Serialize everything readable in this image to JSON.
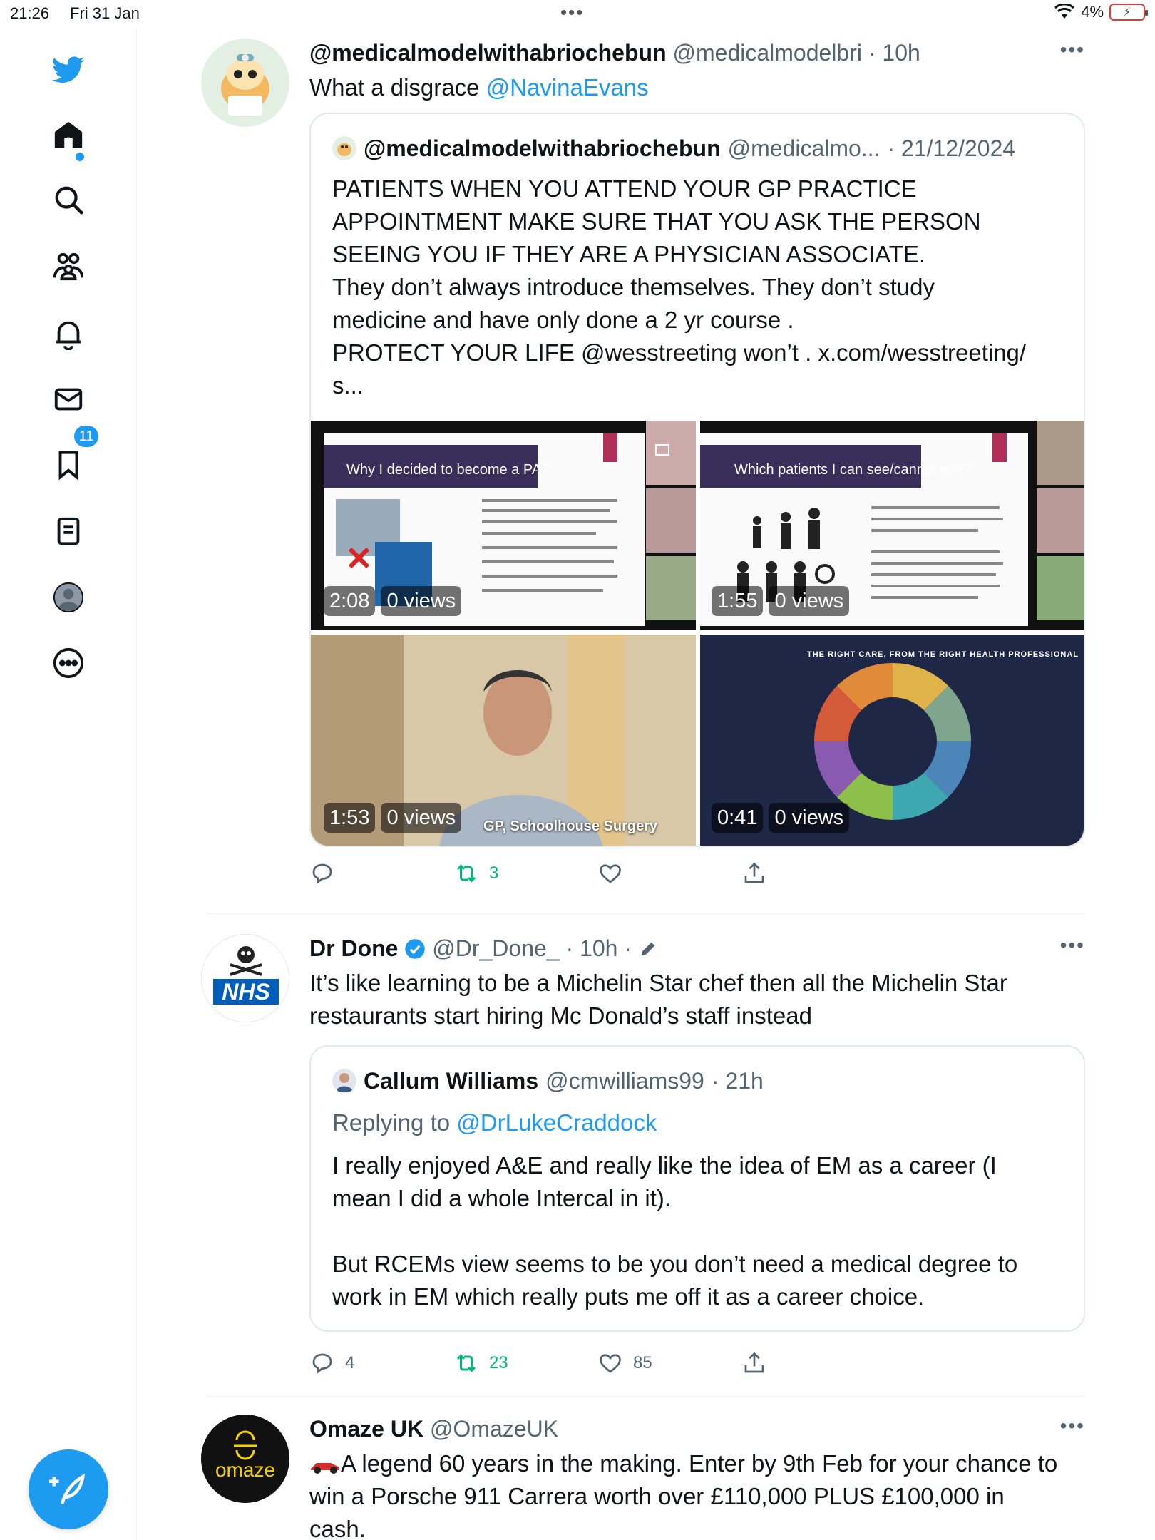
{
  "status_bar": {
    "time": "21:26",
    "date": "Fri 31 Jan",
    "battery": "4%"
  },
  "sidebar": {
    "items": [
      {
        "icon": "twitter-bird-icon"
      },
      {
        "icon": "home-icon"
      },
      {
        "icon": "search-icon"
      },
      {
        "icon": "communities-icon"
      },
      {
        "icon": "notifications-icon",
        "badge": "11"
      },
      {
        "icon": "messages-icon"
      },
      {
        "icon": "bookmarks-icon"
      },
      {
        "icon": "lists-icon"
      },
      {
        "icon": "profile-icon"
      },
      {
        "icon": "more-icon"
      }
    ],
    "compose_icon": "compose-icon"
  },
  "tweets": [
    {
      "name": "@medicalmodelwithabriochebun",
      "handle": "@medicalmodelbri",
      "time": "· 10h",
      "text": "What a disgrace ",
      "mention": "@NavinaEvans",
      "quote": {
        "name": "@medicalmodelwithabriochebun",
        "handle": "@medicalmo...",
        "time": "· 21/12/2024",
        "lines": [
          "PATIENTS WHEN YOU ATTEND YOUR GP PRACTICE",
          "APPOINTMENT MAKE SURE THAT YOU ASK THE PERSON",
          "SEEING YOU IF THEY ARE A PHYSICIAN ASSOCIATE.",
          "They don’t always introduce themselves. They don’t study",
          "medicine and have only done a 2 yr course .",
          "PROTECT YOUR LIFE @wesstreeting won’t . x.com/wesstreeting/",
          "s..."
        ]
      },
      "media": [
        {
          "slide_title": "Why I decided to become a PA?",
          "duration": "2:08",
          "views": "0 views"
        },
        {
          "slide_title": "Which patients I can see/cannot see?",
          "duration": "1:55",
          "views": "0 views"
        },
        {
          "caption": "GP, Schoolhouse Surgery",
          "duration": "1:53",
          "views": "0 views"
        },
        {
          "ring_text": "THE RIGHT CARE, FROM THE RIGHT HEALTH PROFESSIONAL",
          "duration": "0:41",
          "views": "0 views"
        }
      ],
      "actions": {
        "replies": "",
        "retweets": "3",
        "likes": ""
      }
    },
    {
      "name": "Dr Done",
      "handle": "@Dr_Done_",
      "time": "· 10h ·",
      "avatar_text": "NHS",
      "lines": [
        "It’s like learning to be a Michelin Star chef then all the Michelin Star",
        "restaurants start hiring Mc Donald’s staff instead"
      ],
      "quote": {
        "name": "Callum Williams",
        "handle": "@cmwilliams99",
        "time": "· 21h",
        "replying_prefix": "Replying to ",
        "replying_to": "@DrLukeCraddock",
        "lines": [
          "I really enjoyed A&E and really like the idea of EM as a career (I",
          "mean I did a whole Intercal in it).",
          "",
          "But RCEMs view seems to be you don’t need a medical degree to",
          "work in EM which really puts me off it as a career choice."
        ]
      },
      "actions": {
        "replies": "4",
        "retweets": "23",
        "likes": "85"
      }
    },
    {
      "name": "Omaze UK",
      "handle": "@OmazeUK",
      "avatar_text": "omaze",
      "lines": [
        "A legend 60 years in the making. Enter by 9th Feb for your chance to",
        "win a Porsche 911 Carrera worth over £110,000 PLUS £100,000 in",
        "cash."
      ]
    }
  ],
  "colors": {
    "accent": "#1d9bf0",
    "retweet_green": "#00ba7c",
    "text": "#0f1419",
    "muted": "#536471"
  }
}
